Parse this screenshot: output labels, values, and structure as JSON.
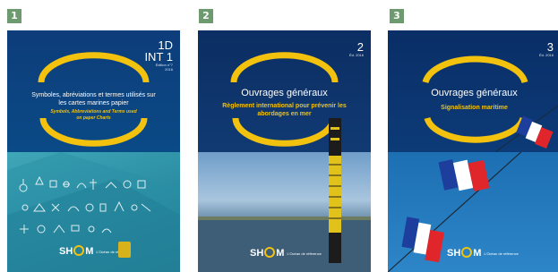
{
  "covers": [
    {
      "badge": "1",
      "volume": "1D",
      "volume_line2": "INT 1",
      "edition": "Édition n°7",
      "year": "2016",
      "title_fr": "Symboles, abréviations et termes utilisés sur les cartes marines papier",
      "title_en": "Symbols, Abbreviations and Terms used on paper Charts",
      "logo_text_left": "SH",
      "logo_text_right": "M",
      "logo_tagline": "L'Océan de référence"
    },
    {
      "badge": "2",
      "volume": "2",
      "edition": "Éd. 2016",
      "title": "Ouvrages généraux",
      "subtitle": "Règlement international pour prévenir les abordages en mer",
      "logo_text_left": "SH",
      "logo_text_right": "M",
      "logo_tagline": "L'Océan de référence"
    },
    {
      "badge": "3",
      "volume": "3",
      "edition": "Éd. 2016",
      "title": "Ouvrages généraux",
      "subtitle": "Signalisation maritime",
      "logo_text_left": "SH",
      "logo_text_right": "M",
      "logo_tagline": "L'Océan de référence"
    }
  ],
  "colors": {
    "badge_green": "#6d9a6e",
    "ring_yellow": "#f2c20e",
    "navy": "#0b2e63"
  }
}
